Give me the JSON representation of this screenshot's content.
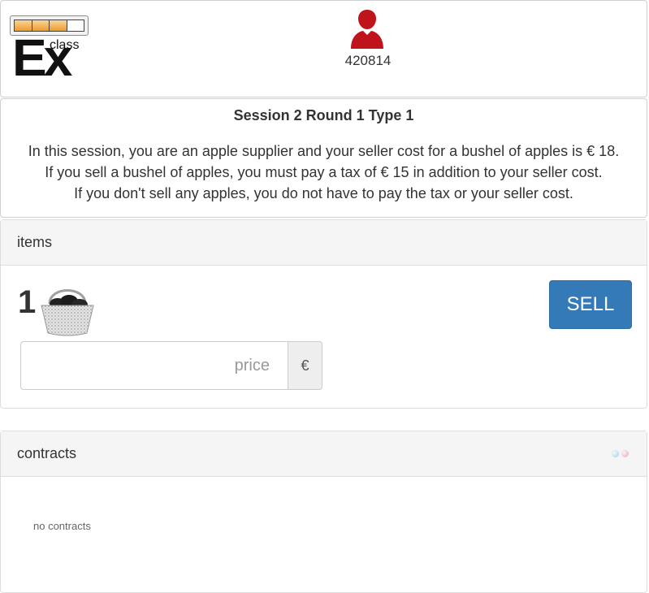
{
  "header": {
    "progress": {
      "filled_segments": 3,
      "total_segments": 4
    },
    "logo": {
      "main": "Ex",
      "sup": "class"
    },
    "user": {
      "icon": "user-icon",
      "id": "420814",
      "color": "#c0141c"
    }
  },
  "info": {
    "title": "Session 2 Round 1 Type 1",
    "lines": [
      "In this session, you are an apple supplier and your seller cost for a bushel of apples is € 18.",
      "If you sell a bushel of apples, you must pay a tax of € 15 in addition to your seller cost.",
      "If you don't sell any apples, you do not have to pay the tax or your seller cost."
    ]
  },
  "items": {
    "heading": "items",
    "quantity": "1",
    "item_icon": "apple-basket-icon",
    "sell_label": "SELL",
    "price_placeholder": "price",
    "currency": "€",
    "accent": "#337ab7"
  },
  "contracts": {
    "heading": "contracts",
    "empty_text": "no contracts",
    "status_icons": [
      "blue-dot-icon",
      "red-dot-icon"
    ]
  }
}
